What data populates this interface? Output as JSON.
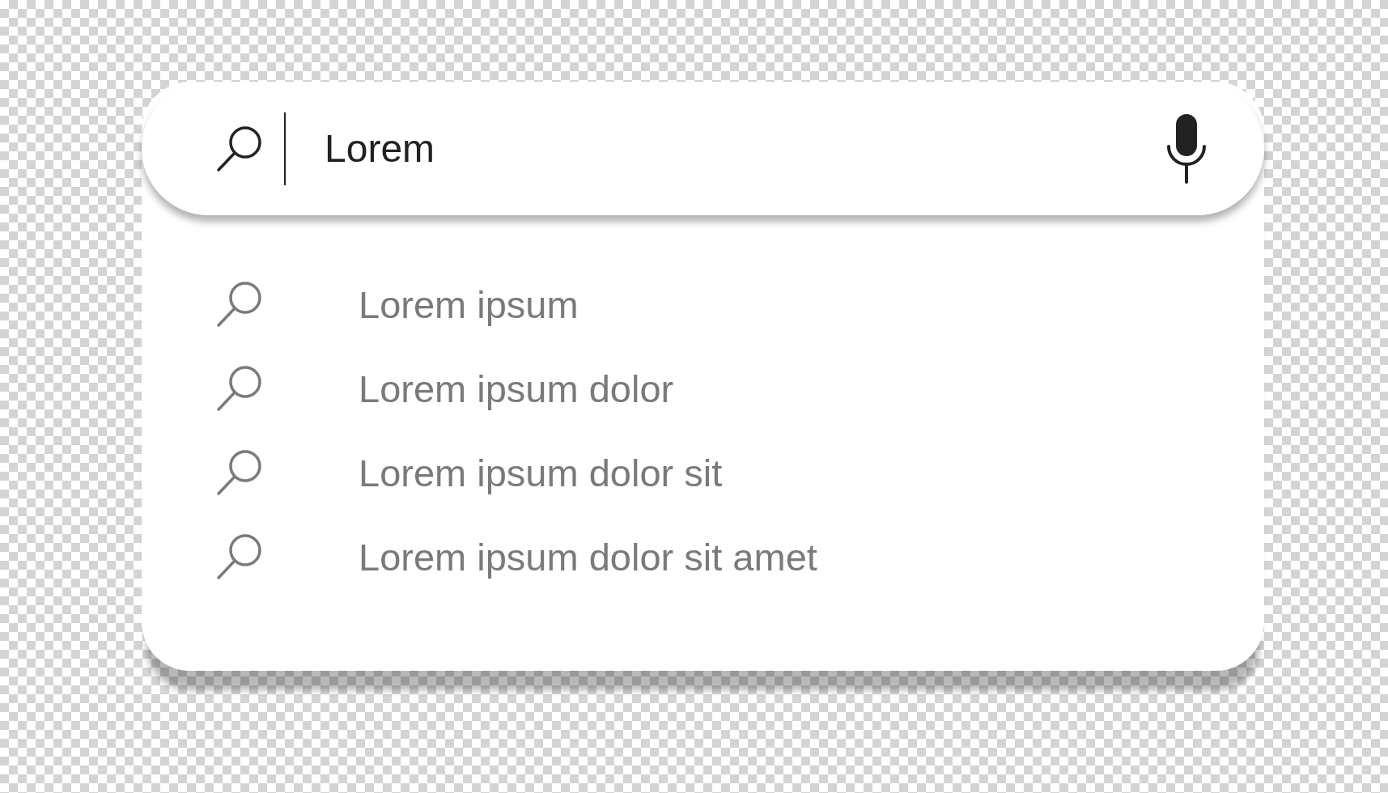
{
  "search": {
    "value": "Lorem"
  },
  "suggestions": [
    {
      "text": "Lorem ipsum"
    },
    {
      "text": "Lorem ipsum dolor"
    },
    {
      "text": "Lorem ipsum dolor sit"
    },
    {
      "text": "Lorem ipsum dolor sit amet"
    }
  ]
}
